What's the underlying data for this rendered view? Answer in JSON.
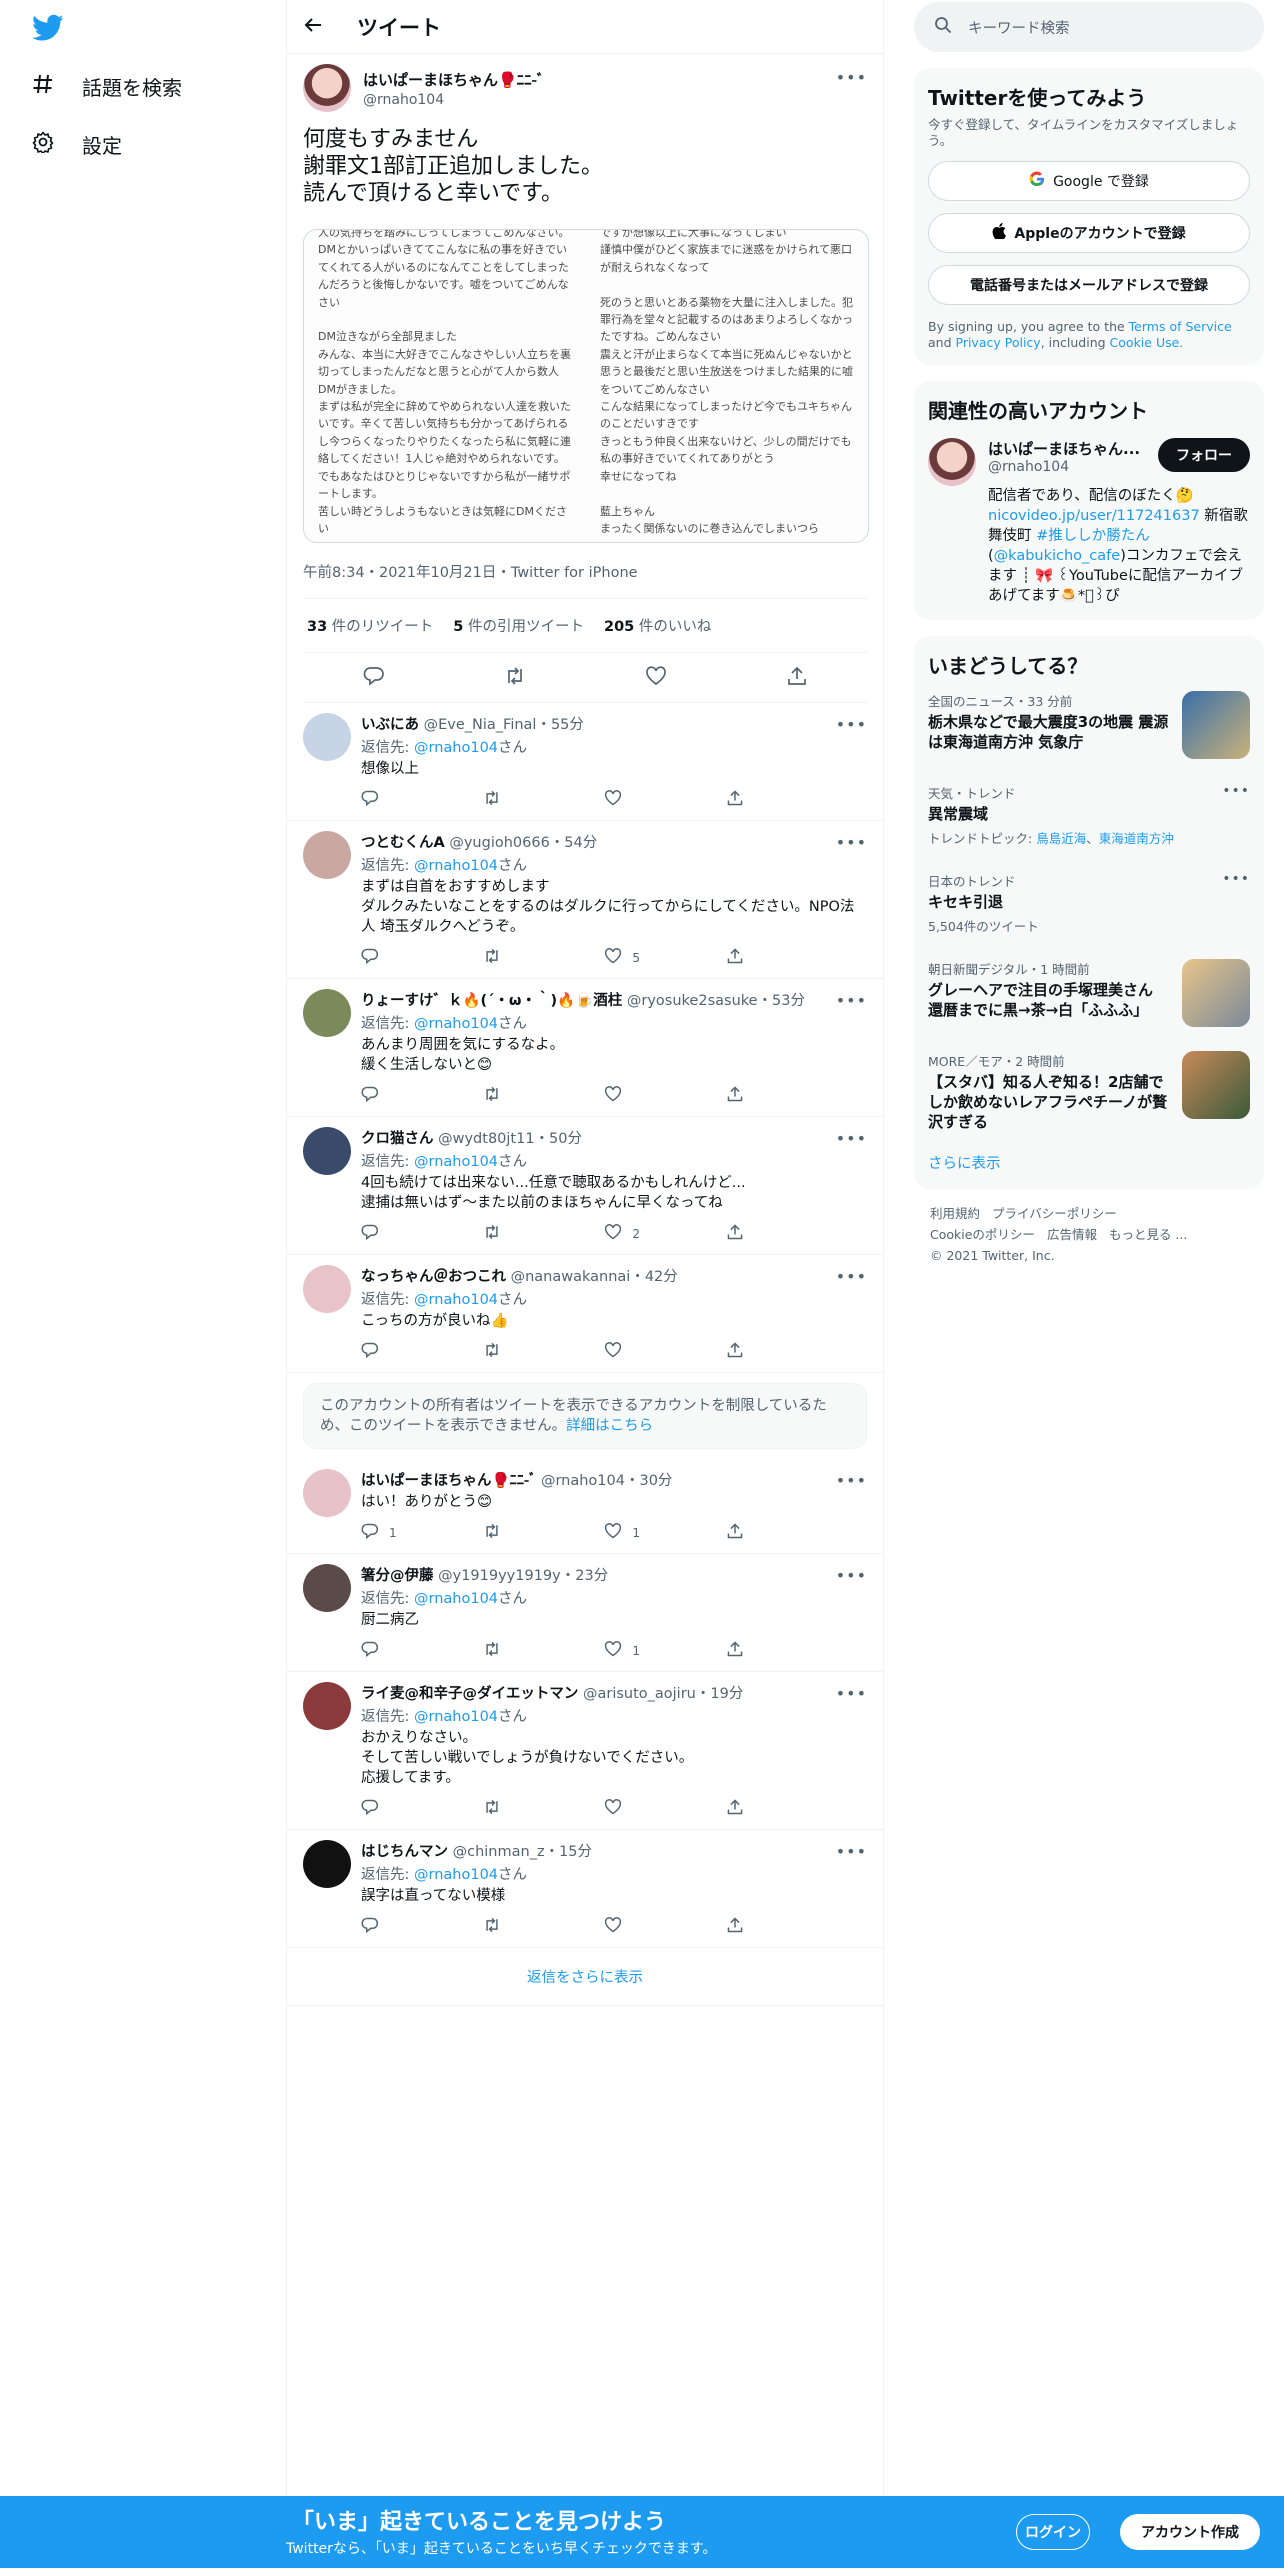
{
  "nav": {
    "explore_label": "話題を検索",
    "settings_label": "設定"
  },
  "header": {
    "title": "ツイート"
  },
  "tweet": {
    "name": "はいぱーまほちゃん🥊ﾆﾆ-ﾞ",
    "handle": "@rnaho104",
    "text": "何度もすみません\n謝罪文1部訂正追加しました。\n読んで頂けると幸いです。",
    "image_left": "人の気持ちを踏みにじってしまってごめんなさい。DMとかいっぱいきててこんなに私の事を好きでいてくれてる人がいるのになんてことをしてしまったんだろうと後悔しかないです。嘘をついてごめんなさい\n\nDM泣きながら全部見ました\nみんな、本当に大好きでこんなさやしい人立ちを裏切ってしまったんだなと思うと心がて人から数人DMがきました。\nまずは私が完全に辞めてやめられない人達を救いたいです。辛くて苦しい気持ちも分かってあげられるし今つらくなったりやりたくなったら私に気軽に連絡してください！1人じゃ絶対やめられないです。でもあなたはひとりじゃないですから私が一緒サポートします。\n苦しい時どうしようもないときは気軽にDMください",
    "image_right": "ですが想像以上に大事になってしまい\n謹慎中僕がひどく家族までに迷惑をかけられて悪口が耐えられなくなって\n\n死のうと思いとある薬物を大量に注入しました。犯罪行為を堂々と記載するのはあまりよろしくなかったですね。ごめんなさい\n震えと汗が止まらなくて本当に死ぬんじゃないかと思うと最後だと思い生放送をつけました結果的に嘘をついてごめんなさい\nこんな結果になってしまったけど今でもユキちゃんのことだいすきです\nきっともう仲良く出来ないけど、少しの間だけでも私の事好きでいてくれてありがとう\n幸せになってね\n\n藍上ちゃん\nまったく関係ないのに巻き込んでしまいつら",
    "meta": "午前8:34・2021年10月21日・Twitter for iPhone",
    "retweets_count": "33",
    "retweets_label": "件のリツイート",
    "quotes_count": "5",
    "quotes_label": "件の引用ツイート",
    "likes_count": "205",
    "likes_label": "件のいいね"
  },
  "reply_prefix": "返信先:",
  "reply_to": "@rnaho104",
  "reply_suffix": "さん",
  "replies": [
    {
      "name": "いぶにあ",
      "handle": "@Eve_Nia_Final",
      "time": "・55分",
      "text": "想像以上",
      "replies": "",
      "retweets": "",
      "likes": "",
      "has_to": true
    },
    {
      "name": "つとむくんA",
      "handle": "@yugioh0666",
      "time": "・54分",
      "text": "まずは自首をおすすめします\nダルクみたいなことをするのはダルクに行ってからにしてください。NPO法人 埼玉ダルクへどうぞ。",
      "replies": "",
      "retweets": "",
      "likes": "5",
      "has_to": true
    },
    {
      "name": "りょーすけ゛ｋ🔥(´・ω・｀)🔥🍺酒柱",
      "handle": "@ryosuke2sasuke",
      "time": "・53分",
      "text": "あんまり周囲を気にするなよ。\n緩く生活しないと😊",
      "replies": "",
      "retweets": "",
      "likes": "",
      "has_to": true
    },
    {
      "name": "クロ猫さん",
      "handle": "@wydt80jt11",
      "time": "・50分",
      "text": "4回も続けては出来ない...任意で聴取あるかもしれんけど...\n逮捕は無いはず〜また以前のまほちゃんに早くなってね",
      "replies": "",
      "retweets": "",
      "likes": "2",
      "has_to": true
    },
    {
      "name": "なっちゃん＠おつこれ",
      "handle": "@nanawakannai",
      "time": "・42分",
      "text": "こっちの方が良いね👍",
      "replies": "",
      "retweets": "",
      "likes": "",
      "has_to": true
    }
  ],
  "restricted": {
    "text": "このアカウントの所有者はツイートを表示できるアカウントを制限しているため、このツイートを表示できません。",
    "link": "詳細はこちら"
  },
  "replies2": [
    {
      "name": "はいぱーまほちゃん🥊ﾆﾆ-ﾞ",
      "handle": "@rnaho104",
      "time": "・30分",
      "text": "はい！ありがとう😊",
      "replies": "1",
      "retweets": "",
      "likes": "1",
      "has_to": false
    },
    {
      "name": "箸分@伊藤",
      "handle": "@y1919yy1919y",
      "time": "・23分",
      "text": "厨二病乙",
      "replies": "",
      "retweets": "",
      "likes": "1",
      "has_to": true
    },
    {
      "name": "ライ麦@和辛子@ダイエットマン",
      "handle": "@arisuto_aojiru",
      "time": "・19分",
      "text": "おかえりなさい。\nそして苦しい戦いでしょうが負けないでください。\n応援してます。",
      "replies": "",
      "retweets": "",
      "likes": "",
      "has_to": true
    },
    {
      "name": "はじちんマン",
      "handle": "@chinman_z",
      "time": "・15分",
      "text": "誤字は直ってない模様",
      "replies": "",
      "retweets": "",
      "likes": "",
      "has_to": true
    }
  ],
  "show_more": "返信をさらに表示",
  "right": {
    "search_placeholder": "キーワード検索",
    "signup_title": "Twitterを使ってみよう",
    "signup_sub": "今すぐ登録して、タイムラインをカスタマイズしましょう。",
    "google_btn": "Google で登録",
    "apple_btn": "Appleのアカウントで登録",
    "phone_btn": "電話番号またはメールアドレスで登録",
    "terms_pre": "By signing up, you agree to the ",
    "terms_tos": "Terms of Service",
    "terms_and": " and ",
    "terms_privacy": "Privacy Policy",
    "terms_inc": ", including ",
    "terms_cookie": "Cookie Use.",
    "related_title": "関連性の高いアカウント",
    "rel_name": "はいぱーまほちゃん...",
    "rel_handle": "@rnaho104",
    "follow_btn": "フォロー",
    "bio_1": "配信者であり、配信のぼたく🤔",
    "bio_link1": "nicovideo.jp/user/117241637",
    "bio_2": " 新宿歌舞伎町 ",
    "bio_tag": "#推ししか勝たん",
    "bio_3": "(",
    "bio_link2": "@kabukicho_cafe",
    "bio_4": ")コンカフェで会えます ┊ 🎀 ꒰YouTubeに配信アーカイブあげてます🍮*ﾟ꒱ぴ",
    "trends_title": "いまどうしてる？",
    "trends": [
      {
        "cat": "全国のニュース・33 分前",
        "name": "栃木県などで最大震度3の地震 震源は東海道南方沖 気象庁",
        "extra": "",
        "thumb": true,
        "more": false
      },
      {
        "cat": "天気・トレンド",
        "name": "異常震域",
        "extra": "トレンドトピック: ",
        "links": [
          "鳥島近海",
          "東海道南方沖"
        ],
        "thumb": false,
        "more": true
      },
      {
        "cat": "日本のトレンド",
        "name": "キセキ引退",
        "extra": "5,504件のツイート",
        "thumb": false,
        "more": true
      },
      {
        "cat": "朝日新聞デジタル・1 時間前",
        "name": "グレーヘアで注目の手塚理美さん　還暦までに黒→茶→白「ふふふ」",
        "extra": "",
        "thumb": true,
        "more": false
      },
      {
        "cat": "MORE／モア・2 時間前",
        "name": "【スタバ】知る人ぞ知る！2店舗でしか飲めないレアフラペチーノが贅沢すぎる",
        "extra": "",
        "thumb": true,
        "more": false
      }
    ],
    "show_more": "さらに表示",
    "footer_links": [
      "利用規約",
      "プライバシーポリシー",
      "Cookieのポリシー",
      "広告情報",
      "もっと見る ..."
    ],
    "copyright": "© 2021 Twitter, Inc."
  },
  "bottom": {
    "big": "「いま」起きていることを見つけよう",
    "small": "Twitterなら、「いま」起きていることをいち早くチェックできます。",
    "login": "ログイン",
    "signup": "アカウント作成"
  }
}
